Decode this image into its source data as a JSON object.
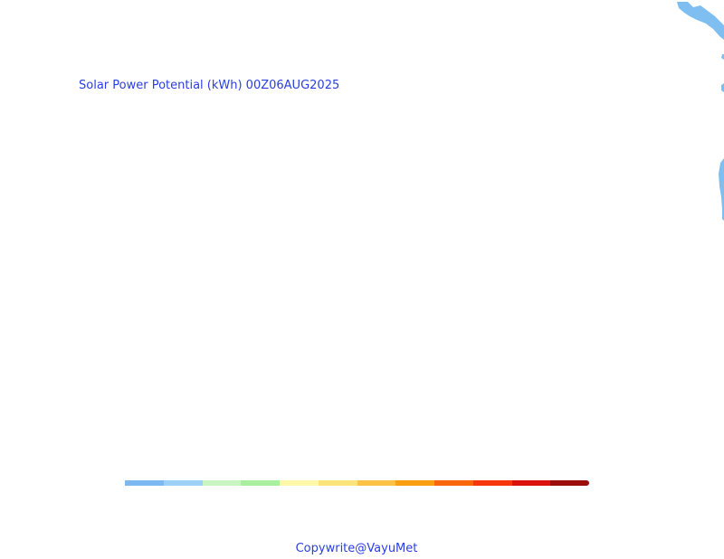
{
  "map": {
    "title": "Solar Power Potential (kWh) 00Z06AUG2025",
    "water_color": "#7fbef0",
    "background_color": "#ffffff",
    "text_color": "#2a3ee0"
  },
  "colorbar": {
    "colors": [
      "#7cb9f2",
      "#9dd2f6",
      "#c9f5c2",
      "#aaeea0",
      "#fff8a8",
      "#fde47a",
      "#fbc246",
      "#f99f10",
      "#fa660c",
      "#f8360b",
      "#da120b",
      "#9c0c0a"
    ]
  },
  "footer": {
    "copyright": "Copywrite@VayuMet"
  }
}
